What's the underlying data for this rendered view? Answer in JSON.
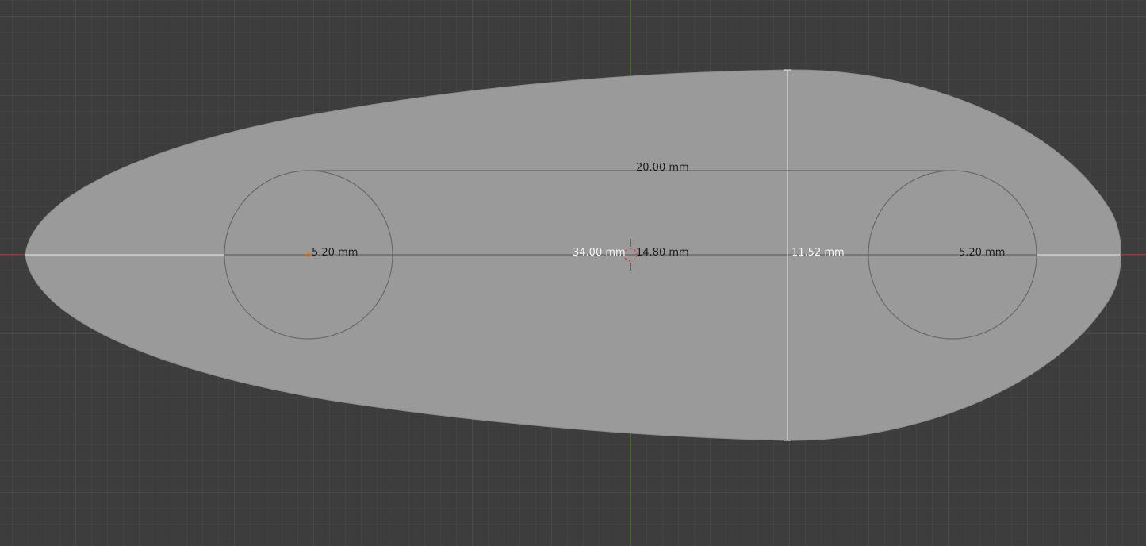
{
  "viewport": {
    "background_color": "#3d3d3d",
    "grid_minor_color": "#454545",
    "grid_major_color": "#4f4f4f",
    "x_axis_color": "#b0343e",
    "y_axis_color": "#5d8a1e"
  },
  "part": {
    "fill_color": "#9a9a9a",
    "outline_color": "#888888"
  },
  "holes": [
    {
      "name": "left-hole",
      "diameter_label": "5.20 mm"
    },
    {
      "name": "right-hole",
      "diameter_label": "5.20 mm"
    }
  ],
  "dimensions": {
    "hole_spacing": "20.00 mm",
    "left_length": "34.00 mm",
    "right_length": "14.80 mm",
    "height": "11.52 mm"
  },
  "colors": {
    "dimension_line_light": "#e8e8e8",
    "dimension_line_dark": "#4a4a4a",
    "origin_point": "#e07a1a",
    "cursor_ring": "#c0303a"
  },
  "icons": {
    "cursor": "3d-cursor-icon",
    "origin": "origin-point-icon"
  }
}
